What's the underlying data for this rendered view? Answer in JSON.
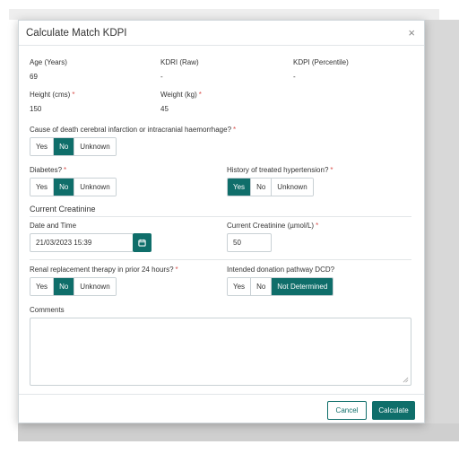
{
  "dialog": {
    "title": "Calculate Match KDPI",
    "close_icon": "×"
  },
  "summary": {
    "age_label": "Age (Years)",
    "age_value": "69",
    "kdri_label": "KDRI (Raw)",
    "kdri_value": "-",
    "kdpi_label": "KDPI (Percentile)",
    "kdpi_value": "-",
    "height_label": "Height (cms)",
    "height_value": "150",
    "weight_label": "Weight (kg)",
    "weight_value": "45",
    "required_marker": "*"
  },
  "cause_of_death": {
    "label": "Cause of death cerebral infarction or intracranial haemorrhage?",
    "options": [
      "Yes",
      "No",
      "Unknown"
    ],
    "selected": "No"
  },
  "diabetes": {
    "label": "Diabetes?",
    "options": [
      "Yes",
      "No",
      "Unknown"
    ],
    "selected": "No"
  },
  "hypertension": {
    "label": "History of treated hypertension?",
    "options": [
      "Yes",
      "No",
      "Unknown"
    ],
    "selected": "Yes"
  },
  "creatinine": {
    "section_title": "Current Creatinine",
    "date_label": "Date and Time",
    "date_value": "21/03/2023 15:39",
    "value_label": "Current Creatinine (µmol/L)",
    "value": "50"
  },
  "renal": {
    "label": "Renal replacement therapy in prior 24 hours?",
    "options": [
      "Yes",
      "No",
      "Unknown"
    ],
    "selected": "No"
  },
  "dcd": {
    "label": "Intended donation pathway DCD?",
    "options": [
      "Yes",
      "No",
      "Not Determined"
    ],
    "selected": "Not Determined"
  },
  "comments": {
    "label": "Comments",
    "value": ""
  },
  "footer": {
    "cancel_label": "Cancel",
    "calculate_label": "Calculate"
  },
  "colors": {
    "accent": "#0f6e6a",
    "required": "#d9534f"
  }
}
